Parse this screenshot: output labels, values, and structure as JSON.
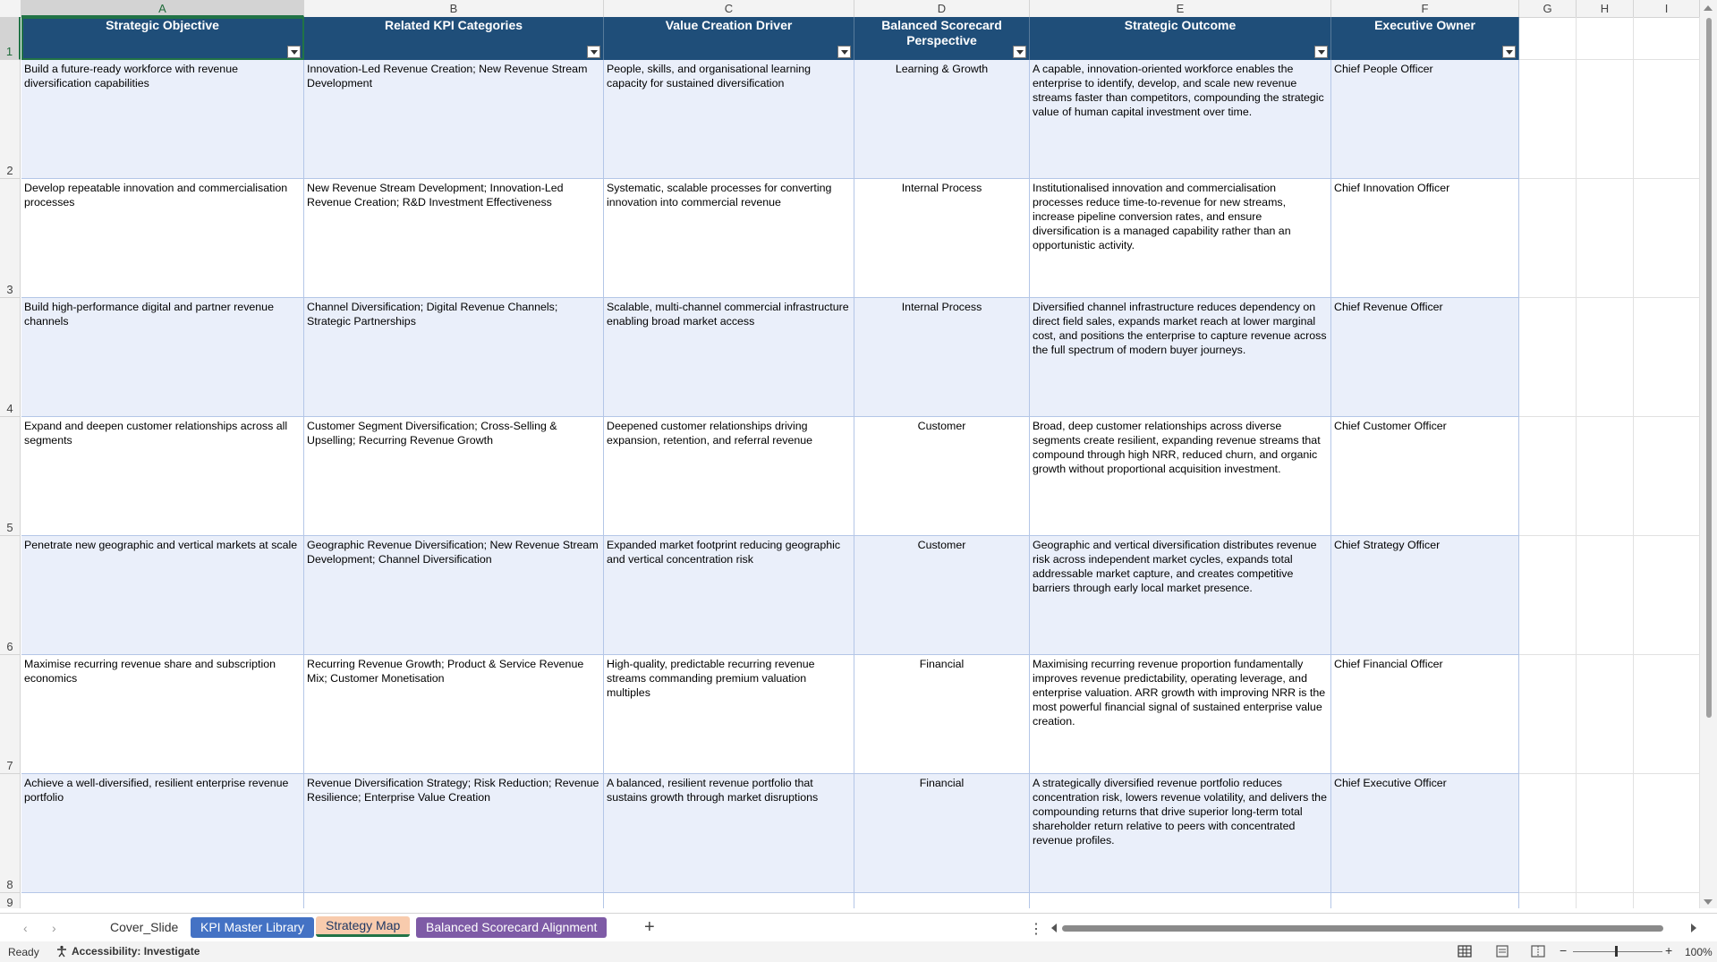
{
  "columns": [
    "A",
    "B",
    "C",
    "D",
    "E",
    "F",
    "G",
    "H",
    "I"
  ],
  "rows": [
    "1",
    "2",
    "3",
    "4",
    "5",
    "6",
    "7",
    "8",
    "9"
  ],
  "headers": [
    "Strategic Objective",
    "Related KPI Categories",
    "Value Creation Driver",
    "Balanced Scorecard Perspective",
    "Strategic Outcome",
    "Executive Owner"
  ],
  "data": [
    {
      "objective": "Build a future-ready workforce with revenue diversification capabilities",
      "kpi": "Innovation-Led Revenue Creation; New Revenue Stream Development",
      "driver": "People, skills, and organisational learning capacity for sustained diversification",
      "perspective": "Learning & Growth",
      "outcome": "A capable, innovation-oriented workforce enables the enterprise to identify, develop, and scale new revenue streams faster than competitors, compounding the strategic value of human capital investment over time.",
      "owner": "Chief People Officer"
    },
    {
      "objective": "Develop repeatable innovation and commercialisation processes",
      "kpi": "New Revenue Stream Development; Innovation-Led Revenue Creation; R&D Investment Effectiveness",
      "driver": "Systematic, scalable processes for converting innovation into commercial revenue",
      "perspective": "Internal Process",
      "outcome": "Institutionalised innovation and commercialisation processes reduce time-to-revenue for new streams, increase pipeline conversion rates, and ensure diversification is a managed capability rather than an opportunistic activity.",
      "owner": "Chief Innovation Officer"
    },
    {
      "objective": "Build high-performance digital and partner revenue channels",
      "kpi": "Channel Diversification; Digital Revenue Channels; Strategic Partnerships",
      "driver": "Scalable, multi-channel commercial infrastructure enabling broad market access",
      "perspective": "Internal Process",
      "outcome": "Diversified channel infrastructure reduces dependency on direct field sales, expands market reach at lower marginal cost, and positions the enterprise to capture revenue across the full spectrum of modern buyer journeys.",
      "owner": "Chief Revenue Officer"
    },
    {
      "objective": "Expand and deepen customer relationships across all segments",
      "kpi": "Customer Segment Diversification; Cross-Selling & Upselling; Recurring Revenue Growth",
      "driver": "Deepened customer relationships driving expansion, retention, and referral revenue",
      "perspective": "Customer",
      "outcome": "Broad, deep customer relationships across diverse segments create resilient, expanding revenue streams that compound through high NRR, reduced churn, and organic growth without proportional acquisition investment.",
      "owner": "Chief Customer Officer"
    },
    {
      "objective": "Penetrate new geographic and vertical markets at scale",
      "kpi": "Geographic Revenue Diversification; New Revenue Stream Development; Channel Diversification",
      "driver": "Expanded market footprint reducing geographic and vertical concentration risk",
      "perspective": "Customer",
      "outcome": "Geographic and vertical diversification distributes revenue risk across independent market cycles, expands total addressable market capture, and creates competitive barriers through early local market presence.",
      "owner": "Chief Strategy Officer"
    },
    {
      "objective": "Maximise recurring revenue share and subscription economics",
      "kpi": "Recurring Revenue Growth; Product & Service Revenue Mix; Customer Monetisation",
      "driver": "High-quality, predictable recurring revenue streams commanding premium valuation multiples",
      "perspective": "Financial",
      "outcome": "Maximising recurring revenue proportion fundamentally improves revenue predictability, operating leverage, and enterprise valuation. ARR growth with improving NRR is the most powerful financial signal of sustained enterprise value creation.",
      "owner": "Chief Financial Officer"
    },
    {
      "objective": "Achieve a well-diversified, resilient enterprise revenue portfolio",
      "kpi": "Revenue Diversification Strategy; Risk Reduction; Revenue Resilience; Enterprise Value Creation",
      "driver": "A balanced, resilient revenue portfolio that sustains growth through market disruptions",
      "perspective": "Financial",
      "outcome": "A strategically diversified revenue portfolio reduces concentration risk, lowers revenue volatility, and delivers the compounding returns that drive superior long-term total shareholder return relative to peers with concentrated revenue profiles.",
      "owner": "Chief Executive Officer"
    }
  ],
  "tabs": [
    "Cover_Slide",
    "KPI Master Library",
    "Strategy Map",
    "Balanced Scorecard Alignment"
  ],
  "add_tab": "+",
  "status": {
    "ready": "Ready",
    "accessibility": "Accessibility: Investigate",
    "zoom": "100%"
  },
  "colors": {
    "header_bg": "#1f4e79",
    "band": "#eaeffa",
    "tab_kpi": "#4472c4",
    "tab_strat": "#f8cbad",
    "tab_bsa": "#7e5ba6"
  }
}
